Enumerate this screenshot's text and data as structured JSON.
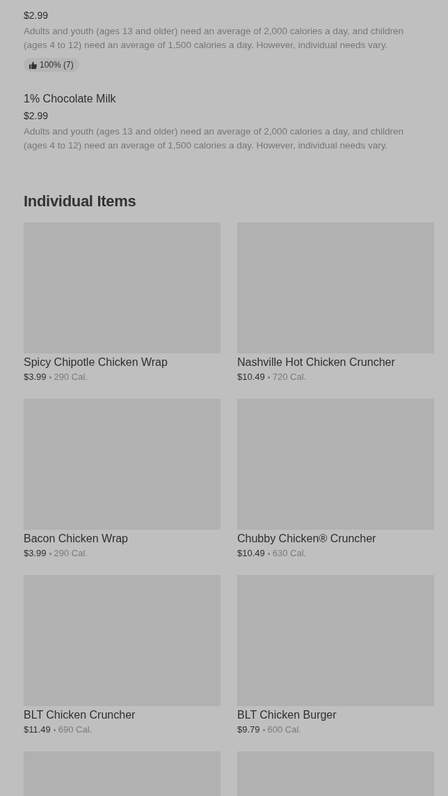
{
  "drinks": [
    {
      "price": "$2.99",
      "description": "Adults and youth (ages 13 and older) need an average of 2,000 calories a day, and children (ages 4 to 12) need an average of 1,500 calories a day. However, individual needs vary.",
      "rating": "100% (7)"
    },
    {
      "name": "1% Chocolate Milk",
      "price": "$2.99",
      "description": "Adults and youth (ages 13 and older) need an average of 2,000 calories a day, and children (ages 4 to 12) need an average of 1,500 calories a day. However, individual needs vary."
    }
  ],
  "section": {
    "title": "Individual Items",
    "items": [
      {
        "kind": "item",
        "name": "Spicy Chipotle Chicken Wrap",
        "price": "$3.99",
        "calories": "290 Cal."
      },
      {
        "kind": "item",
        "name": "Nashville Hot Chicken Cruncher",
        "price": "$10.49",
        "calories": "720 Cal."
      },
      {
        "kind": "item",
        "name": "Bacon Chicken Wrap",
        "price": "$3.99",
        "calories": "290 Cal."
      },
      {
        "kind": "item",
        "name": "Chubby Chicken® Cruncher",
        "price": "$10.49",
        "calories": "630 Cal."
      },
      {
        "kind": "item",
        "name": "BLT Chicken Cruncher",
        "price": "$11.49",
        "calories": "690 Cal."
      },
      {
        "kind": "item",
        "name": "BLT Chicken Burger",
        "price": "$9.79",
        "calories": "600 Cal."
      },
      {
        "kind": "picture"
      },
      {
        "kind": "picture"
      }
    ]
  }
}
